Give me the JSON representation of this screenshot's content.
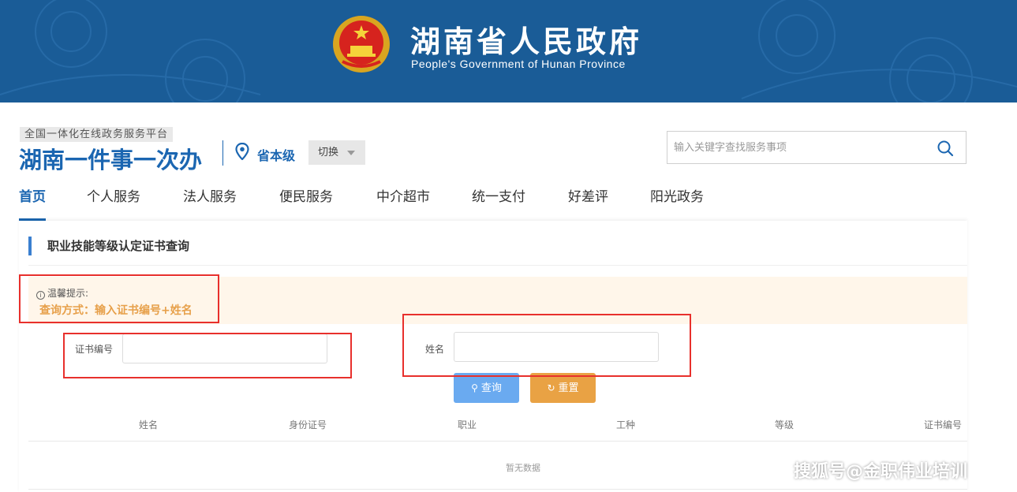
{
  "banner": {
    "title": "湖南省人民政府",
    "subtitle": "People's Government of Hunan Province",
    "background_color": "#1a5c97"
  },
  "header": {
    "platform_tag": "全国一体化在线政务服务平台",
    "brand": "湖南一件事一次办",
    "location_icon": "map-pin-icon",
    "location": "省本级",
    "switch_label": "切换",
    "search_placeholder": "输入关键字查找服务事项",
    "search_icon": "search-icon",
    "accent_color": "#1b66b1"
  },
  "nav": {
    "items": [
      {
        "label": "首页",
        "active": true
      },
      {
        "label": "个人服务",
        "active": false
      },
      {
        "label": "法人服务",
        "active": false
      },
      {
        "label": "便民服务",
        "active": false
      },
      {
        "label": "中介超市",
        "active": false
      },
      {
        "label": "统一支付",
        "active": false
      },
      {
        "label": "好差评",
        "active": false
      },
      {
        "label": "阳光政务",
        "active": false
      }
    ]
  },
  "page": {
    "section_title": "职业技能等级认定证书查询",
    "tip_title": "温馨提示:",
    "tip_text": "查询方式：输入证书编号+姓名",
    "fields": {
      "cert_label": "证书编号",
      "cert_value": "",
      "name_label": "姓名",
      "name_value": ""
    },
    "buttons": {
      "query": "查询",
      "reset": "重置"
    },
    "table": {
      "columns": [
        "姓名",
        "身份证号",
        "职业",
        "工种",
        "等级",
        "证书编号"
      ],
      "rows": [],
      "empty_text": "暂无数据"
    }
  },
  "watermark": "搜狐号@金职伟业培训"
}
